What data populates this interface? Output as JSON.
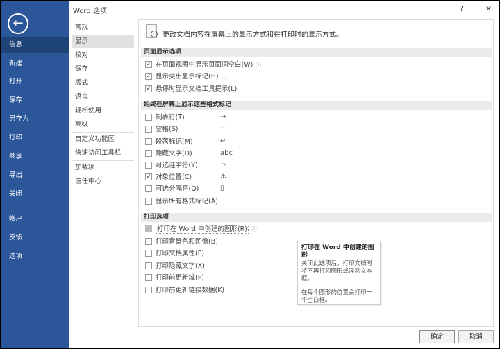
{
  "sidebar": {
    "items": [
      "信息",
      "新建",
      "打开",
      "保存",
      "另存为",
      "打印",
      "共享",
      "导出",
      "关闭",
      "帐户",
      "反馈",
      "选项"
    ]
  },
  "dialog": {
    "title": "Word 选项",
    "help": "?",
    "close": "✕"
  },
  "categories": [
    "常规",
    "显示",
    "校对",
    "保存",
    "版式",
    "语言",
    "轻松使用",
    "高级",
    "自定义功能区",
    "快速访问工具栏",
    "加载项",
    "信任中心"
  ],
  "content": {
    "header": "更改文档内容在屏幕上的显示方式和在打印时的显示方式。",
    "page_section": "页面显示选项",
    "page_options": [
      {
        "label": "在页面视图中显示页面间空白(W)",
        "checked": true
      },
      {
        "label": "显示突出显示标记(H)",
        "checked": true
      },
      {
        "label": "悬停时显示文档工具提示(L)",
        "checked": true
      }
    ],
    "marks_section": "始终在屏幕上显示这些格式标记",
    "marks": [
      {
        "label": "制表符(T)",
        "checked": false,
        "symbol": "→"
      },
      {
        "label": "空格(S)",
        "checked": false,
        "symbol": "···"
      },
      {
        "label": "段落标记(M)",
        "checked": false,
        "symbol": "↵"
      },
      {
        "label": "隐藏文字(D)",
        "checked": false,
        "symbol": "abc"
      },
      {
        "label": "可选连字符(Y)",
        "checked": false,
        "symbol": "¬"
      },
      {
        "label": "对象位置(C)",
        "checked": true,
        "symbol": "⚓"
      },
      {
        "label": "可选分隔符(O)",
        "checked": false,
        "symbol": "▯"
      },
      {
        "label": "显示所有格式标记(A)",
        "checked": false
      }
    ],
    "print_section": "打印选项",
    "print_options": [
      {
        "label": "打印在 Word 中创建的图形(R)",
        "checked": false
      },
      {
        "label": "打印背景色和图像(B)",
        "checked": false
      },
      {
        "label": "打印文档属性(P)",
        "checked": false
      },
      {
        "label": "打印隐藏文字(X)",
        "checked": false
      },
      {
        "label": "打印前更新域(F)",
        "checked": false
      },
      {
        "label": "打印前更新链接数据(K)",
        "checked": false
      }
    ],
    "tooltip": {
      "title": "打印在 Word 中创建的图形",
      "p1": "关闭此选项后，打印文档时将不再打印图形或浮动文本框。",
      "p2": "在每个图形的位置会打印一个空白框。"
    }
  },
  "buttons": {
    "ok": "确定",
    "cancel": "取消"
  },
  "check": "✓"
}
